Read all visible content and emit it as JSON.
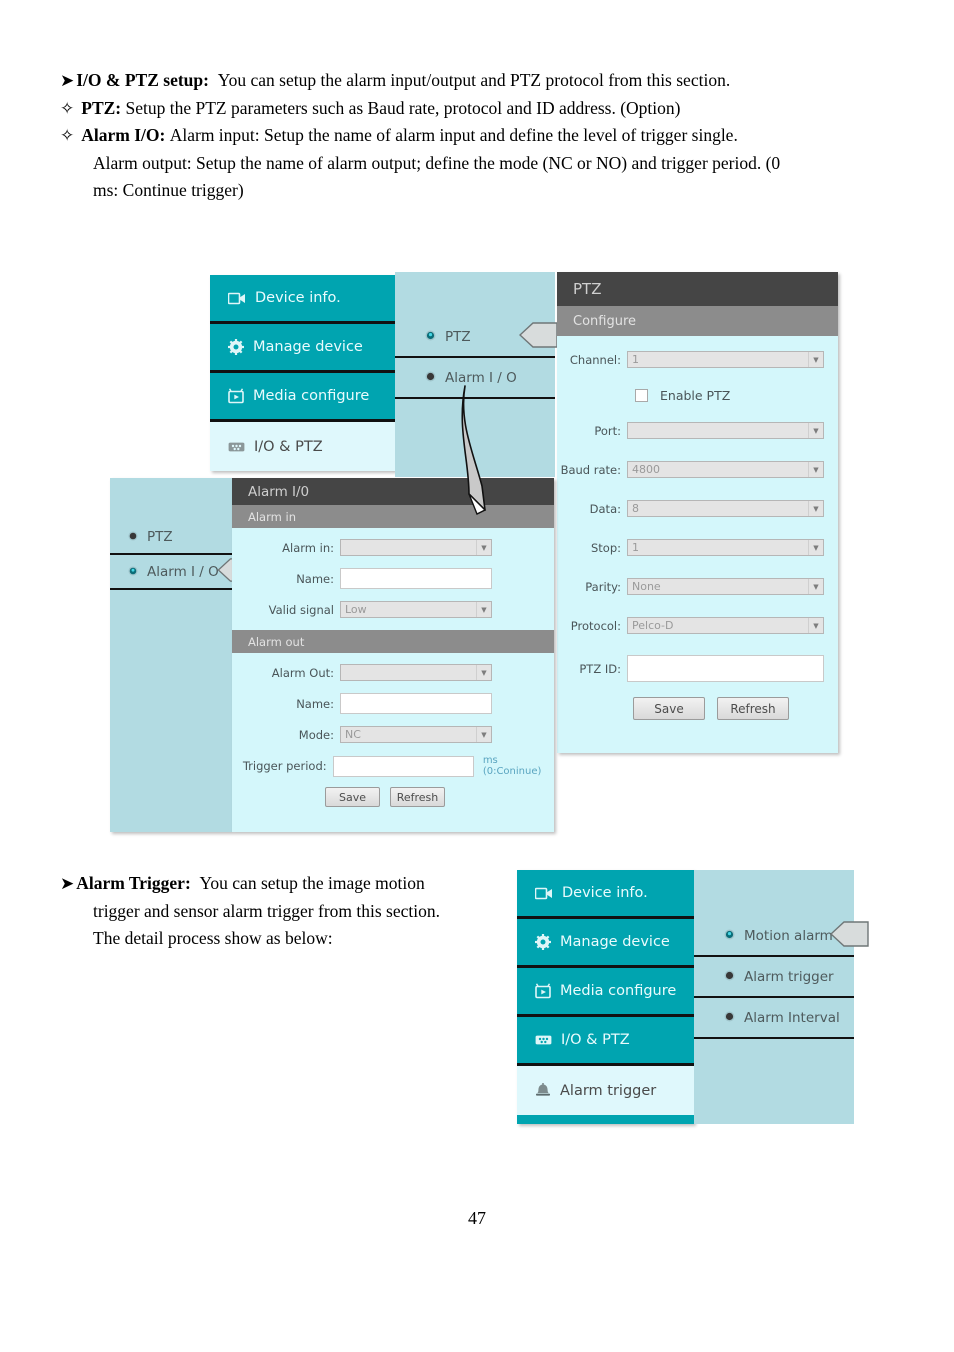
{
  "document": {
    "paragraphs": [
      {
        "bullet": "arrow",
        "bold": "I/O & PTZ setup:",
        "text": "You can setup the alarm input/output and PTZ protocol from this section."
      },
      {
        "bullet": "diamond",
        "bold": "PTZ:",
        "text": "Setup the PTZ parameters such as Baud rate, protocol and ID address. (Option)"
      },
      {
        "bullet": "diamond",
        "bold": "Alarm I/O:",
        "text": "Alarm input: Setup the name of alarm input and define the level of trigger single."
      }
    ],
    "continuation_lines": [
      "Alarm output: Setup the name of alarm output; define the mode (NC or NO) and trigger period.    (0",
      "ms: Continue trigger)"
    ],
    "alarm_trigger_block": {
      "bullet": "arrow",
      "bold": "Alarm Trigger:",
      "lines": [
        "You can setup the image motion",
        "trigger and sensor alarm trigger from this section.",
        "The detail process show as below:"
      ]
    },
    "page_number": "47"
  },
  "figure_top": {
    "main_menu": {
      "items": [
        {
          "label": "Device info.",
          "icon": "video-camera-icon",
          "active": false
        },
        {
          "label": "Manage device",
          "icon": "gear-icon",
          "active": false
        },
        {
          "label": "Media configure",
          "icon": "media-tv-icon",
          "active": false
        },
        {
          "label": "I/O & PTZ",
          "icon": "io-ports-icon",
          "active": true
        }
      ]
    },
    "submenu_top": {
      "items": [
        {
          "label": "PTZ",
          "selected": true,
          "icon": "radio-dot-icon"
        },
        {
          "label": "Alarm I / O",
          "selected": false,
          "icon": "radio-dot-icon"
        }
      ]
    },
    "submenu_lower": {
      "items": [
        {
          "label": "PTZ",
          "selected": false,
          "icon": "radio-dot-icon"
        },
        {
          "label": "Alarm I / O",
          "selected": true,
          "icon": "radio-dot-icon"
        }
      ]
    },
    "ptz_panel": {
      "title": "PTZ",
      "section": "Configure",
      "fields": [
        {
          "label": "Channel:",
          "value": "1",
          "type": "select"
        },
        {
          "label": "Port:",
          "value": "",
          "type": "select"
        },
        {
          "label": "Baud rate:",
          "value": "4800",
          "type": "select"
        },
        {
          "label": "Data:",
          "value": "8",
          "type": "select"
        },
        {
          "label": "Stop:",
          "value": "1",
          "type": "select"
        },
        {
          "label": "Parity:",
          "value": "None",
          "type": "select"
        },
        {
          "label": "Protocol:",
          "value": "Pelco-D",
          "type": "select"
        },
        {
          "label": "PTZ ID:",
          "value": "",
          "type": "text"
        }
      ],
      "checkbox": {
        "label": "Enable PTZ",
        "checked": false
      },
      "buttons": {
        "save": "Save",
        "refresh": "Refresh"
      }
    },
    "alarm_io_panel": {
      "title": "Alarm I/0",
      "section_in": "Alarm in",
      "section_out": "Alarm out",
      "fields_in": [
        {
          "label": "Alarm in:",
          "value": "",
          "type": "select"
        },
        {
          "label": "Name:",
          "value": "",
          "type": "text"
        },
        {
          "label": "Valid signal",
          "value": "Low",
          "type": "select"
        }
      ],
      "fields_out": [
        {
          "label": "Alarm Out:",
          "value": "",
          "type": "select"
        },
        {
          "label": "Name:",
          "value": "",
          "type": "text"
        },
        {
          "label": "Mode:",
          "value": "NC",
          "type": "select"
        },
        {
          "label": "Trigger period:",
          "value": "",
          "type": "text"
        }
      ],
      "hint": "ms (0:Coninue)",
      "buttons": {
        "save": "Save",
        "refresh": "Refresh"
      }
    }
  },
  "figure_bottom": {
    "main_menu": {
      "items": [
        {
          "label": "Device info.",
          "icon": "video-camera-icon",
          "active": false
        },
        {
          "label": "Manage device",
          "icon": "gear-icon",
          "active": false
        },
        {
          "label": "Media configure",
          "icon": "media-tv-icon",
          "active": false
        },
        {
          "label": "I/O & PTZ",
          "icon": "io-ports-icon",
          "active": false
        },
        {
          "label": "Alarm trigger",
          "icon": "bell-icon",
          "active": true
        }
      ]
    },
    "submenu": {
      "items": [
        {
          "label": "Motion alarm",
          "selected": true,
          "icon": "radio-dot-icon"
        },
        {
          "label": "Alarm trigger",
          "selected": false,
          "icon": "radio-dot-icon"
        },
        {
          "label": "Alarm Interval",
          "selected": false,
          "icon": "radio-dot-icon"
        }
      ]
    }
  },
  "colors": {
    "teal": "#00a4b0",
    "light_cyan": "#d4f7fb",
    "submenu_blue": "#b2dbe2",
    "panel_title_dark": "#454545",
    "panel_sub_gray": "#8c8c8c",
    "hint_blue": "#5aa5c0"
  }
}
